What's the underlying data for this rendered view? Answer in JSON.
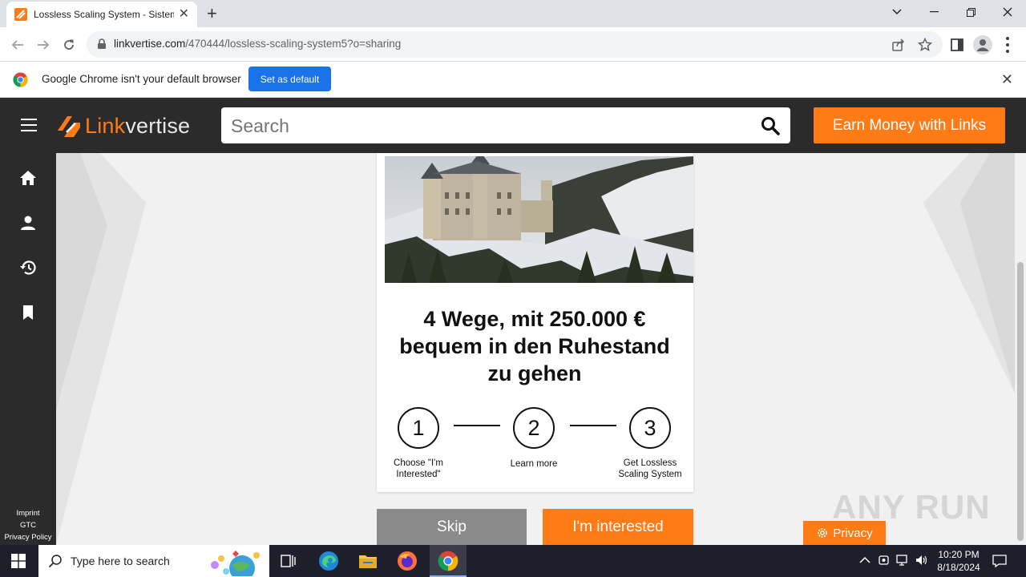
{
  "browser": {
    "tab_title": "Lossless Scaling System - Sistem",
    "url_host": "linkvertise.com",
    "url_path": "/470444/lossless-scaling-system5?o=sharing",
    "infobar_message": "Google Chrome isn't your default browser",
    "infobar_button": "Set as default"
  },
  "header": {
    "logo_part1": "Link",
    "logo_part2": "vertise",
    "search_placeholder": "Search",
    "earn_button": "Earn Money with Links"
  },
  "sidenav": {
    "icons": [
      "home-icon",
      "user-icon",
      "history-icon",
      "bookmark-icon"
    ],
    "links": [
      "Imprint",
      "GTC",
      "Privacy Policy"
    ]
  },
  "ad_card": {
    "headline": "4 Wege, mit 250.000 € bequem in den Ruhestand zu gehen",
    "steps": [
      {
        "number": "1",
        "label": "Choose \"I'm Interested\""
      },
      {
        "number": "2",
        "label": "Learn more"
      },
      {
        "number": "3",
        "label": "Get Lossless Scaling System"
      }
    ]
  },
  "actions": {
    "skip": "Skip",
    "interested": "I'm interested",
    "privacy": "Privacy"
  },
  "watermark": "ANY RUN",
  "taskbar": {
    "search_text": "Type here to search",
    "time": "10:20 PM",
    "date": "8/18/2024"
  },
  "colors": {
    "accent_orange": "#ff7b16",
    "header_dark": "#2b2b2b",
    "chrome_blue": "#1a73e8"
  }
}
